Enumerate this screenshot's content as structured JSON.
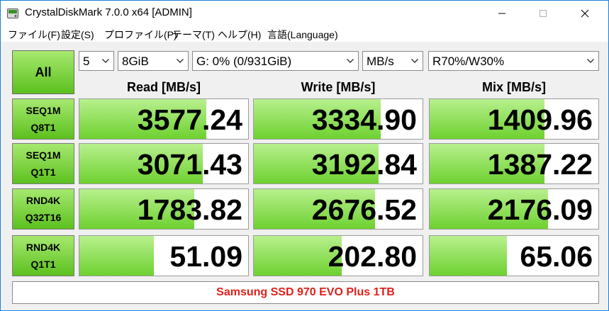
{
  "window": {
    "title": "CrystalDiskMark 7.0.0 x64 [ADMIN]",
    "accent_color": "#1a7fd8"
  },
  "menu": {
    "items": [
      "ファイル(F)",
      "設定(S)",
      "プロファイル(P)",
      "テーマ(T)",
      "ヘルプ(H)",
      "言語(Language)"
    ]
  },
  "controls": {
    "all_label": "All",
    "count": "5",
    "size": "8GiB",
    "drive": "G: 0% (0/931GiB)",
    "unit": "MB/s",
    "mix": "R70%/W30%"
  },
  "columns": [
    "Read [MB/s]",
    "Write [MB/s]",
    "Mix [MB/s]"
  ],
  "rows": [
    {
      "line1": "SEQ1M",
      "line2": "Q8T1",
      "read": "3577.24",
      "write": "3334.90",
      "mix": "1409.96",
      "read_fill": 0.75,
      "write_fill": 0.75,
      "mix_fill": 0.68
    },
    {
      "line1": "SEQ1M",
      "line2": "Q1T1",
      "read": "3071.43",
      "write": "3192.84",
      "mix": "1387.22",
      "read_fill": 0.73,
      "write_fill": 0.74,
      "mix_fill": 0.68
    },
    {
      "line1": "RND4K",
      "line2": "Q32T16",
      "read": "1783.82",
      "write": "2676.52",
      "mix": "2176.09",
      "read_fill": 0.68,
      "write_fill": 0.72,
      "mix_fill": 0.7
    },
    {
      "line1": "RND4K",
      "line2": "Q1T1",
      "read": "51.09",
      "write": "202.80",
      "mix": "65.06",
      "read_fill": 0.44,
      "write_fill": 0.52,
      "mix_fill": 0.46
    }
  ],
  "comment": "Samsung SSD 970 EVO Plus 1TB",
  "colors": {
    "bar_green": "#6ed130",
    "label_green": "#5cc01e",
    "comment_red": "#e0201a"
  }
}
